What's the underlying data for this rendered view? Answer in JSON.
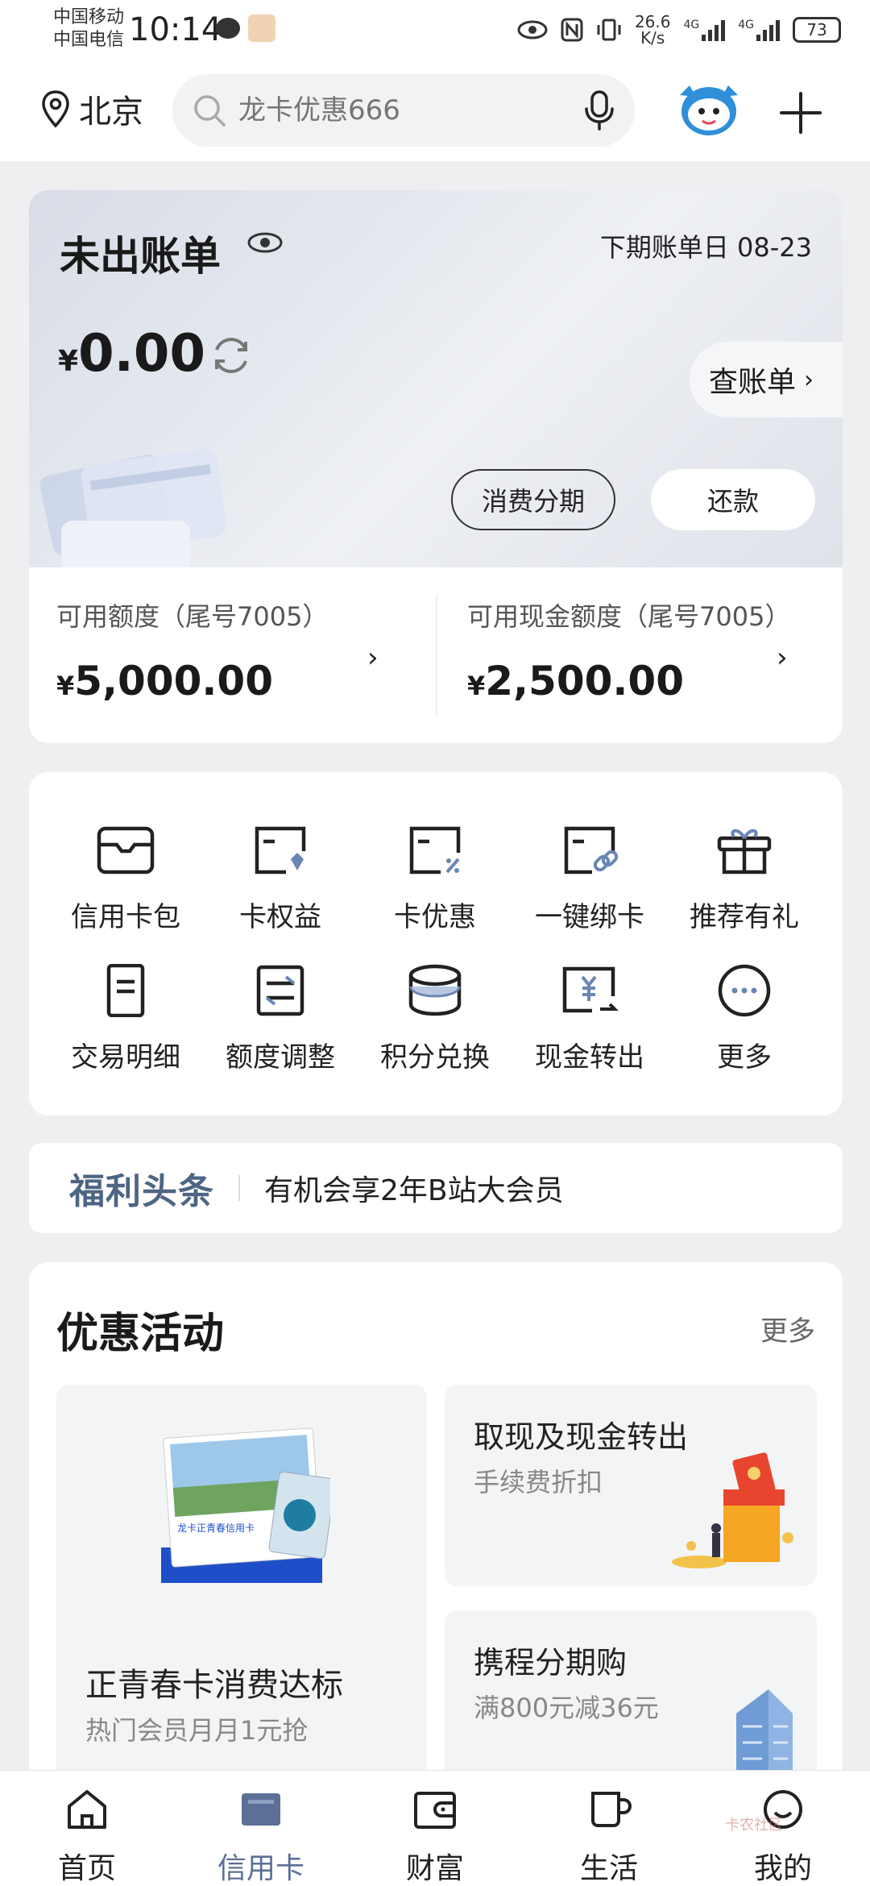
{
  "status_bar": {
    "carrier_1": "中国移动",
    "carrier_2": "中国电信",
    "time": "10:14",
    "net_speed_value": "26.6",
    "net_speed_unit": "K/s",
    "net_1": "4G",
    "net_2": "4G",
    "battery": "73"
  },
  "header": {
    "city": "北京",
    "search_placeholder": "龙卡优惠666"
  },
  "bill": {
    "title": "未出账单",
    "next_bill_label": "下期账单日",
    "next_bill_date": "08-23",
    "currency": "¥",
    "amount": "0.00",
    "check_bill": "查账单",
    "installment_button": "消费分期",
    "repay_button": "还款"
  },
  "credit": {
    "available_label": "可用额度（尾号7005）",
    "available_currency": "¥",
    "available_value": "5,000.00",
    "cash_label": "可用现金额度（尾号7005）",
    "cash_currency": "¥",
    "cash_value": "2,500.00"
  },
  "grid": [
    {
      "label": "信用卡包",
      "icon": "card-wallet-icon"
    },
    {
      "label": "卡权益",
      "icon": "card-rights-icon"
    },
    {
      "label": "卡优惠",
      "icon": "card-discount-icon"
    },
    {
      "label": "一键绑卡",
      "icon": "bind-card-icon"
    },
    {
      "label": "推荐有礼",
      "icon": "gift-icon"
    },
    {
      "label": "交易明细",
      "icon": "transactions-icon"
    },
    {
      "label": "额度调整",
      "icon": "limit-adjust-icon"
    },
    {
      "label": "积分兑换",
      "icon": "points-icon"
    },
    {
      "label": "现金转出",
      "icon": "cash-out-icon"
    },
    {
      "label": "更多",
      "icon": "more-icon"
    }
  ],
  "headline": {
    "tag": "福利头条",
    "text": "有机会享2年B站大会员"
  },
  "promotions": {
    "title": "优惠活动",
    "more": "更多",
    "big": {
      "title": "正青春卡消费达标",
      "subtitle": "热门会员月月1元抢",
      "art_label": "龙卡正青春信用卡"
    },
    "small": [
      {
        "title": "取现及现金转出",
        "subtitle": "手续费折扣"
      },
      {
        "title": "携程分期购",
        "subtitle": "满800元减36元"
      }
    ]
  },
  "bottom_nav": [
    {
      "label": "首页",
      "icon": "home-icon",
      "active": false
    },
    {
      "label": "信用卡",
      "icon": "credit-card-icon",
      "active": true
    },
    {
      "label": "财富",
      "icon": "wallet-icon",
      "active": false
    },
    {
      "label": "生活",
      "icon": "cup-icon",
      "active": false
    },
    {
      "label": "我的",
      "icon": "profile-icon",
      "active": false
    }
  ],
  "colors": {
    "accent": "#5c6f96",
    "headline_tag": "#4e6584"
  },
  "watermark": "卡农社区"
}
